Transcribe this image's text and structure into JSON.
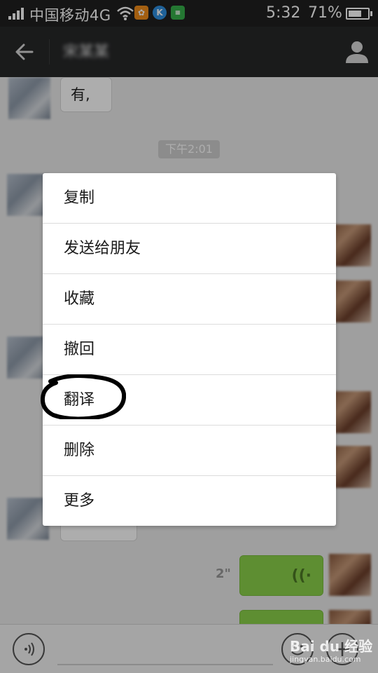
{
  "status_bar": {
    "carrier": "中国移动4G",
    "time": "5:32",
    "battery": "71%",
    "battery_level": 0.71
  },
  "title_bar": {
    "contact_name": "宋某某"
  },
  "chat": {
    "first_message": "有,",
    "time_label": "下午2:01",
    "voice_duration": "2\""
  },
  "context_menu": {
    "items": [
      {
        "label": "复制"
      },
      {
        "label": "发送给朋友"
      },
      {
        "label": "收藏"
      },
      {
        "label": "撤回"
      },
      {
        "label": "翻译"
      },
      {
        "label": "删除"
      },
      {
        "label": "更多"
      }
    ],
    "highlighted_item": "翻译"
  },
  "watermark": {
    "brand": "Bai du 经验",
    "url": "jingyan.baidu.com"
  },
  "colors": {
    "status_bar_bg": "#1f1f1f",
    "title_bar_bg": "#272829",
    "chat_bg": "#ebebeb",
    "sent_bubble": "#8bd24b",
    "annotation": "#000000"
  }
}
